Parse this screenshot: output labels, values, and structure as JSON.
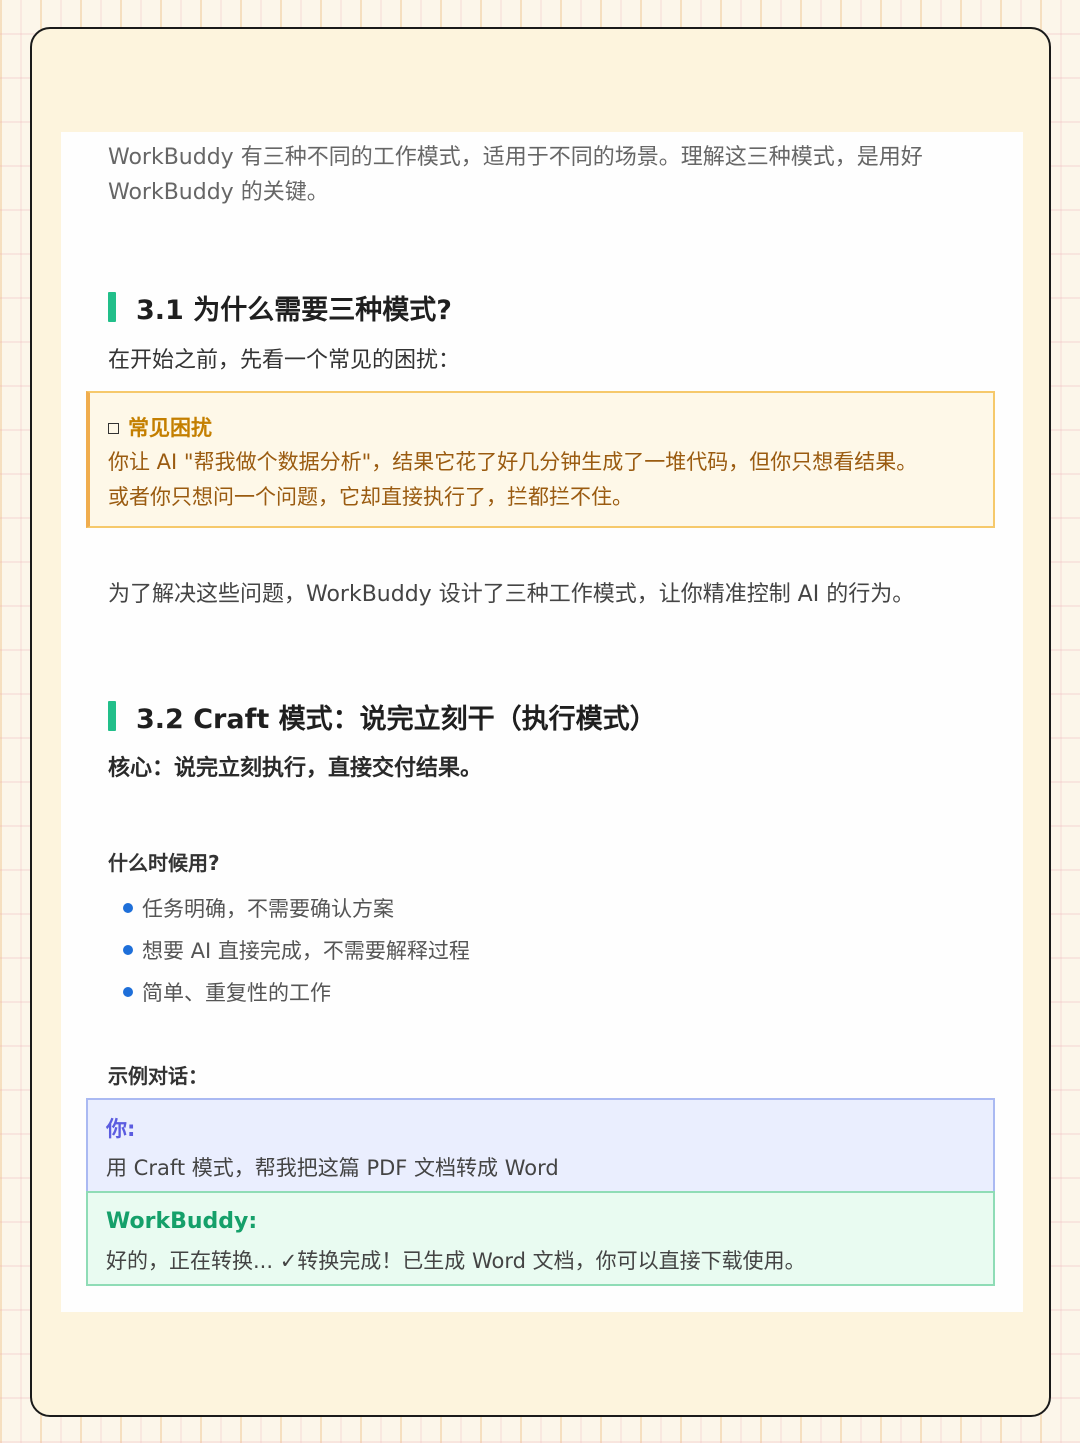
{
  "intro": "WorkBuddy 有三种不同的工作模式，适用于不同的场景。理解这三种模式，是用好 WorkBuddy 的关键。",
  "section_31": {
    "title": "3.1 为什么需要三种模式?",
    "lead": "在开始之前，先看一个常见的困扰：",
    "warning": {
      "title": "常见困扰",
      "line1": "你让 AI \"帮我做个数据分析\"，结果它花了好几分钟生成了一堆代码，但你只想看结果。",
      "line2": "或者你只想问一个问题，它却直接执行了，拦都拦不住。"
    },
    "conclusion": "为了解决这些问题，WorkBuddy 设计了三种工作模式，让你精准控制 AI 的行为。"
  },
  "section_32": {
    "title": "3.2  Craft 模式：说完立刻干（执行模式）",
    "core": "核心：说完立刻执行，直接交付结果。",
    "when_title": "什么时候用?",
    "bullets": [
      "任务明确，不需要确认方案",
      "想要 AI 直接完成，不需要解释过程",
      "简单、重复性的工作"
    ],
    "example_title": "示例对话：",
    "chat": {
      "user_label": "你:",
      "user_text": "用 Craft 模式，帮我把这篇 PDF 文档转成 Word",
      "bot_label": "WorkBuddy:",
      "bot_text": "好的，正在转换...   ✓转换完成！已生成 Word 文档，你可以直接下载使用。"
    }
  },
  "colors": {
    "accent_green": "#22bf8a",
    "warning_border": "#f0ad4e",
    "warning_text": "#9a5b10",
    "bullet_blue": "#1e6fd9",
    "user_label": "#5b5ce0",
    "bot_label": "#15a06a"
  }
}
